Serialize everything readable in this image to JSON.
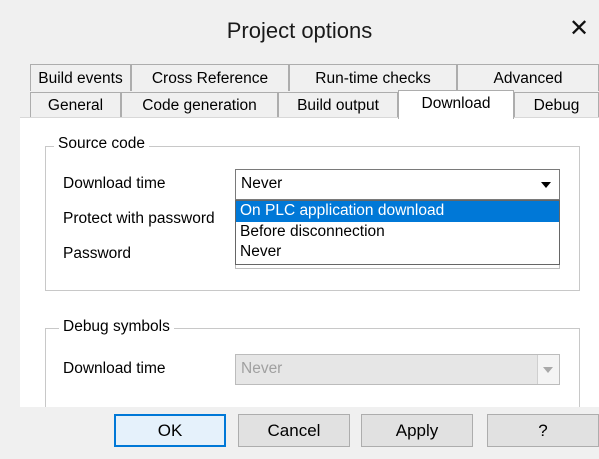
{
  "window": {
    "title": "Project options",
    "close_glyph": "✕"
  },
  "tabs": {
    "back_row": [
      "Build events",
      "Cross Reference",
      "Run-time checks",
      "Advanced"
    ],
    "front_row": [
      "General",
      "Code generation",
      "Build output",
      "Download",
      "Debug"
    ],
    "active": "Download"
  },
  "source_code": {
    "group_label": "Source code",
    "download_time_label": "Download time",
    "download_time_value": "Never",
    "protect_label": "Protect with password",
    "password_label": "Password",
    "dropdown_options": [
      "On PLC application download",
      "Before disconnection",
      "Never"
    ],
    "dropdown_selected_index": 0
  },
  "debug_symbols": {
    "group_label": "Debug symbols",
    "download_time_label": "Download time",
    "download_time_value": "Never"
  },
  "buttons": {
    "ok": "OK",
    "cancel": "Cancel",
    "apply": "Apply",
    "help": "?"
  },
  "colors": {
    "selection": "#0078d7",
    "dialog_bg": "#f0f0f0"
  }
}
